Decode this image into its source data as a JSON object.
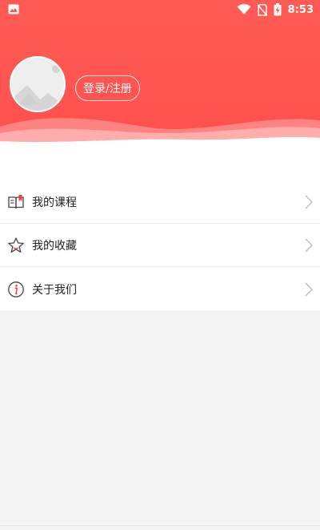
{
  "status_bar": {
    "time": "8:53",
    "icons": [
      "gallery-icon",
      "wifi-icon",
      "no-sim-icon",
      "battery-charging-icon"
    ]
  },
  "profile": {
    "login_label": "登录/注册",
    "avatar_icon": "image-placeholder-icon"
  },
  "menu": {
    "items": [
      {
        "label": "我的课程",
        "icon": "book-icon"
      },
      {
        "label": "我的收藏",
        "icon": "star-icon"
      },
      {
        "label": "关于我们",
        "icon": "info-icon"
      }
    ],
    "chevron_icon": "chevron-right-icon"
  },
  "colors": {
    "header": "#ff524e",
    "accent": "#e64640",
    "background": "#f4f4f4"
  }
}
